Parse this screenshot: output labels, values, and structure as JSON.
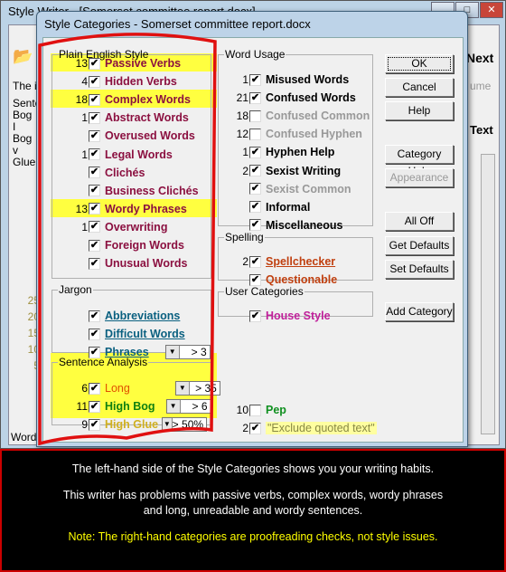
{
  "app": {
    "title": "Style Writer - [Somerset committee report.docx]",
    "toolbar_next": "Next",
    "toolbar_resume": "ume",
    "toolbar_text": "Text",
    "doc_start": "The i",
    "side_items": [
      "Sente",
      "Bog I",
      "Bog v",
      "Glue"
    ],
    "axis_ticks": [
      "25",
      "20",
      "15",
      "10",
      "5"
    ],
    "status": "Words"
  },
  "dialog": {
    "title": "Style Categories - Somerset committee report.docx",
    "plain": {
      "label": "Plain English Style",
      "items": [
        {
          "count": "13",
          "checked": true,
          "label": "Passive Verbs",
          "highlight": true
        },
        {
          "count": "4",
          "checked": true,
          "label": "Hidden Verbs"
        },
        {
          "count": "18",
          "checked": true,
          "label": "Complex Words",
          "highlight": true
        },
        {
          "count": "1",
          "checked": true,
          "label": "Abstract Words"
        },
        {
          "count": "",
          "checked": true,
          "label": "Overused Words"
        },
        {
          "count": "1",
          "checked": true,
          "label": "Legal Words"
        },
        {
          "count": "",
          "checked": true,
          "label": "Clichés"
        },
        {
          "count": "",
          "checked": true,
          "label": "Business Clichés"
        },
        {
          "count": "13",
          "checked": true,
          "label": "Wordy Phrases",
          "highlight": true
        },
        {
          "count": "1",
          "checked": true,
          "label": "Overwriting"
        },
        {
          "count": "",
          "checked": true,
          "label": "Foreign Words"
        },
        {
          "count": "",
          "checked": true,
          "label": "Unusual Words"
        }
      ]
    },
    "jargon": {
      "label": "Jargon",
      "items": [
        {
          "count": "",
          "checked": true,
          "label": "Abbreviations"
        },
        {
          "count": "",
          "checked": true,
          "label": "Difficult Words"
        },
        {
          "count": "",
          "checked": true,
          "label": "Phrases",
          "threshold": "> 3"
        }
      ]
    },
    "sentence": {
      "label": "Sentence Analysis",
      "items": [
        {
          "count": "6",
          "checked": true,
          "label": "Long",
          "threshold": "> 35",
          "color": "#e05000"
        },
        {
          "count": "11",
          "checked": true,
          "label": "High Bog",
          "threshold": "> 6",
          "color": "#108010"
        },
        {
          "count": "9",
          "checked": true,
          "label": "High Glue",
          "threshold": "> 50%",
          "color": "#d0b020"
        }
      ]
    },
    "usage": {
      "label": "Word Usage",
      "items": [
        {
          "count": "1",
          "checked": true,
          "label": "Misused Words"
        },
        {
          "count": "21",
          "checked": true,
          "label": "Confused Words"
        },
        {
          "count": "18",
          "checked": false,
          "label": "Confused Common",
          "dim": true
        },
        {
          "count": "12",
          "checked": false,
          "label": "Confused Hyphen",
          "dim": true
        },
        {
          "count": "1",
          "checked": true,
          "label": "Hyphen Help"
        },
        {
          "count": "2",
          "checked": true,
          "label": "Sexist Writing"
        },
        {
          "count": "",
          "checked": true,
          "label": "Sexist Common",
          "dim": true
        },
        {
          "count": "",
          "checked": true,
          "label": "Informal"
        },
        {
          "count": "",
          "checked": true,
          "label": "Miscellaneous"
        }
      ]
    },
    "spelling": {
      "label": "Spelling",
      "items": [
        {
          "count": "2",
          "checked": true,
          "label": "Spellchecker"
        },
        {
          "count": "",
          "checked": true,
          "label": "Questionable"
        }
      ]
    },
    "user": {
      "label": "User Categories",
      "items": [
        {
          "count": "",
          "checked": true,
          "label": "House Style"
        }
      ]
    },
    "extra": [
      {
        "count": "10",
        "checked": false,
        "label": "Pep"
      },
      {
        "count": "2",
        "checked": true,
        "label": "\"Exclude quoted text\""
      }
    ],
    "buttons": {
      "ok": "OK",
      "cancel": "Cancel",
      "help": "Help",
      "category_help": "Category Help",
      "appearance": "Appearance",
      "all_off": "All Off",
      "get_defaults": "Get Defaults",
      "set_defaults": "Set Defaults",
      "add_category": "Add Category"
    }
  },
  "caption": {
    "line1": "The left-hand side of the Style Categories shows you your writing habits.",
    "line2": "This writer has problems with passive verbs, complex words, wordy phrases and long, unreadable and wordy sentences.",
    "note": "Note:  The right-hand categories are proofreading checks, not style issues."
  },
  "colors": {
    "plain": "#8b1040",
    "jargon": "#0a6080",
    "usage": "#000000",
    "dim": "#999999",
    "spelling": "#c04010",
    "user": "#c0209a",
    "pep": "#109020",
    "quoted": "#888844",
    "highlight": "#ffff40",
    "annotation": "#e01010",
    "note": "#ffff00"
  }
}
